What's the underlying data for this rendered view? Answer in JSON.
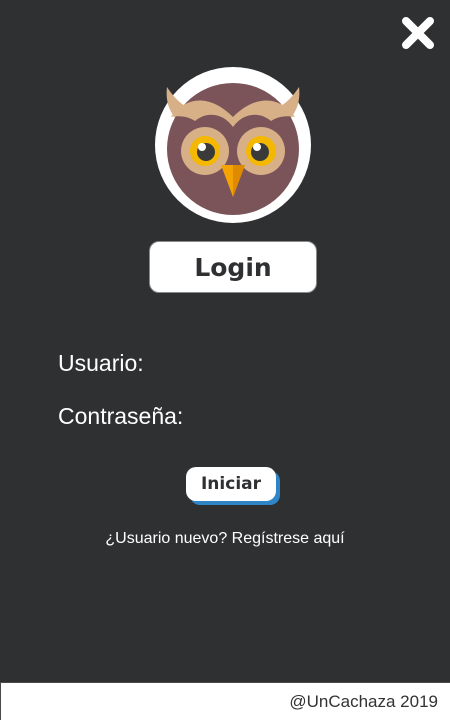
{
  "header": {
    "close_icon": "close-x-icon"
  },
  "logo": {
    "icon": "owl-icon"
  },
  "login": {
    "title": "Login",
    "username_label": "Usuario:",
    "username_value": "",
    "password_label": "Contraseña:",
    "password_value": "",
    "submit_label": "Iniciar",
    "register_link": "¿Usuario nuevo? Regístrese aquí"
  },
  "footer": {
    "credit": "@UnCachaza 2019"
  },
  "colors": {
    "background": "#2f3032",
    "button_shadow": "#2f86c6",
    "owl_face": "#7a5458",
    "owl_feathers": "#d7b088",
    "owl_eye": "#f5b800",
    "owl_beak": "#f5a300"
  }
}
